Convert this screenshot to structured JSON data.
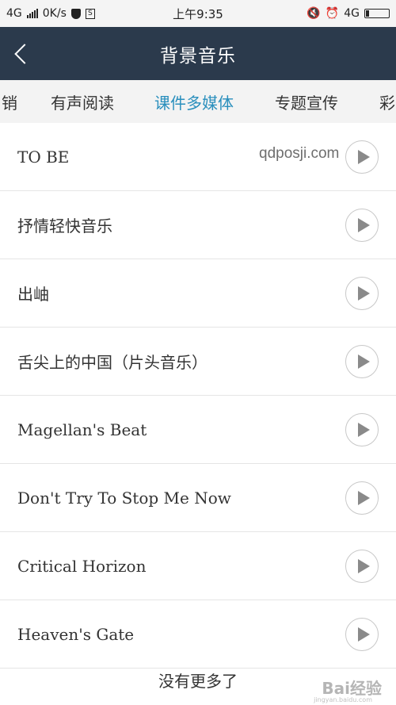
{
  "status_bar": {
    "network": "4G",
    "speed": "0K/s",
    "time": "上午9:35",
    "network_right": "4G",
    "icons": [
      "signal-icon",
      "shield-icon",
      "sim-icon",
      "mute-icon",
      "alarm-icon",
      "battery-icon"
    ]
  },
  "header": {
    "title": "背景音乐",
    "back_icon": "chevron-left-icon"
  },
  "tabs": [
    {
      "label": "销"
    },
    {
      "label": "有声阅读"
    },
    {
      "label": "课件多媒体",
      "active": true
    },
    {
      "label": "专题宣传"
    },
    {
      "label": "彩"
    }
  ],
  "accent_color": "#2a8fbd",
  "header_color": "#2b3a4c",
  "songs": [
    {
      "title": "TO BE"
    },
    {
      "title": "抒情轻快音乐"
    },
    {
      "title": "出岫"
    },
    {
      "title": "舌尖上的中国（片头音乐）"
    },
    {
      "title": "Magellan's Beat"
    },
    {
      "title": "Don't Try To Stop Me Now"
    },
    {
      "title": "Critical Horizon"
    },
    {
      "title": "Heaven's Gate"
    }
  ],
  "play_icon": "play-icon",
  "footer": "没有更多了",
  "watermark": {
    "url": "qdposji.com",
    "logo": "Bai经验",
    "sub": "jingyan.baidu.com"
  }
}
